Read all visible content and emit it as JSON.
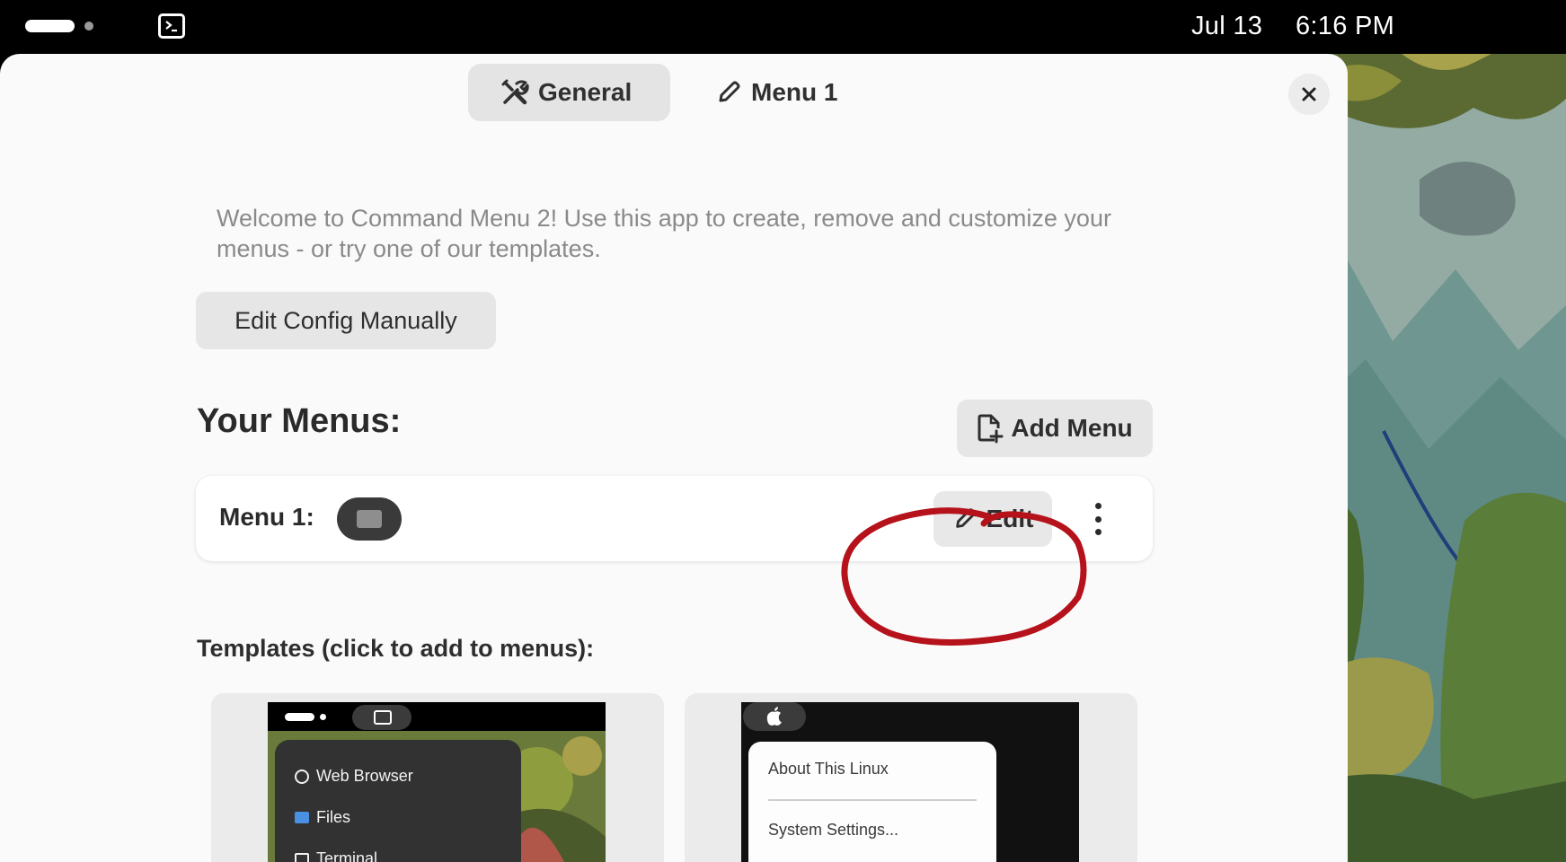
{
  "topbar": {
    "date": "Jul 13",
    "time": "6:16 PM"
  },
  "tabs": [
    {
      "label": "General",
      "icon": "tools-icon",
      "active": true
    },
    {
      "label": "Menu 1",
      "icon": "pencil-icon",
      "active": false
    }
  ],
  "general": {
    "welcome": "Welcome to Command Menu 2! Use this app to create, remove and customize your menus - or try one of our templates.",
    "edit_config_label": "Edit Config Manually",
    "your_menus_heading": "Your Menus:",
    "add_menu_label": "Add Menu",
    "menus": [
      {
        "label": "Menu 1:",
        "edit_label": "Edit"
      }
    ],
    "templates_heading": "Templates (click to add to menus):",
    "templates": [
      {
        "items": [
          "Web Browser",
          "Files",
          "Terminal"
        ]
      },
      {
        "items": [
          "About This Linux",
          "System Settings..."
        ]
      }
    ]
  },
  "colors": {
    "annotation": "#b5121b",
    "window_bg": "#fafafa",
    "button_bg": "#e6e6e6"
  }
}
